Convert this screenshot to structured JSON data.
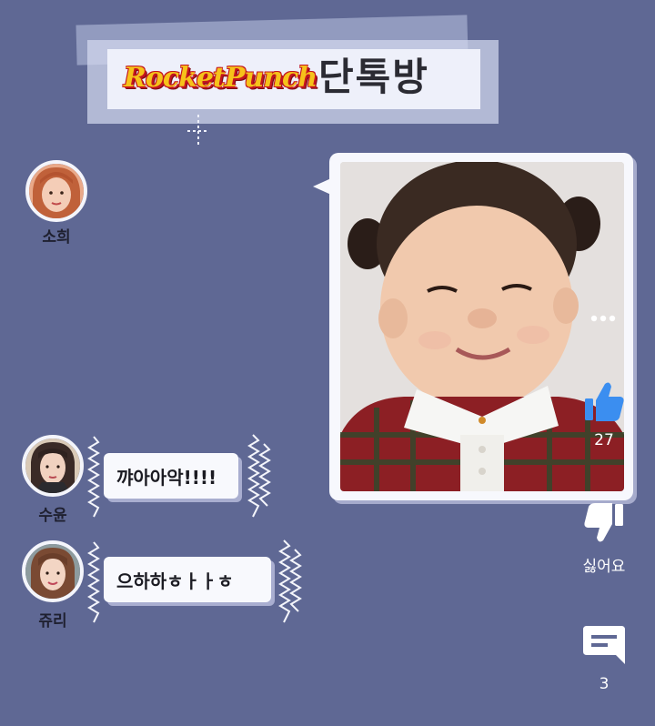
{
  "header": {
    "logo_text": "RocketPunch",
    "room_title": "단톡방"
  },
  "members": [
    {
      "name": "소희"
    },
    {
      "name": "수윤"
    },
    {
      "name": "쥬리"
    }
  ],
  "messages": [
    {
      "sender": "소희",
      "type": "photo"
    },
    {
      "sender": "수윤",
      "text": "꺄아아악!!!!"
    },
    {
      "sender": "쥬리",
      "text": "으하하ㅎㅏㅏㅎ"
    }
  ],
  "actions": {
    "more_icon": "more-dots-icon",
    "like": {
      "icon": "thumbs-up-icon",
      "count": "27",
      "color": "#3b8ef0"
    },
    "dislike": {
      "icon": "thumbs-down-icon",
      "label": "싫어요"
    },
    "comment": {
      "icon": "comment-icon",
      "count": "3"
    }
  },
  "colors": {
    "background": "#5f6894",
    "bubble": "#f8f9fd",
    "like_accent": "#3b8ef0"
  }
}
